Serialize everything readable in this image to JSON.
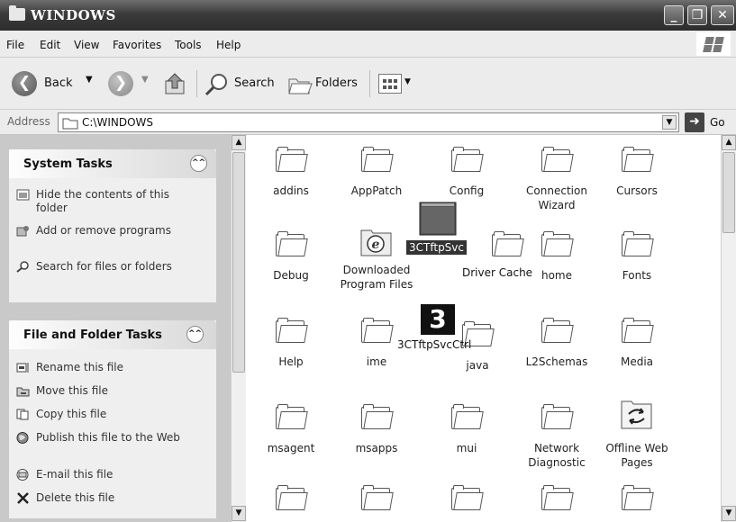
{
  "window": {
    "title": "WINDOWS"
  },
  "menu": [
    "File",
    "Edit",
    "View",
    "Favorites",
    "Tools",
    "Help"
  ],
  "toolbar": {
    "back": "Back",
    "search": "Search",
    "folders": "Folders"
  },
  "address": {
    "label": "Address",
    "value": "C:\\WINDOWS",
    "go": "Go"
  },
  "system_tasks": {
    "title": "System Tasks",
    "items": [
      {
        "icon": "hide-contents-icon",
        "label": "Hide the contents of this folder"
      },
      {
        "icon": "add-remove-programs-icon",
        "label": "Add or remove programs"
      },
      {
        "icon": "search-icon",
        "label": "Search for files or folders"
      }
    ]
  },
  "file_tasks": {
    "title": "File and Folder Tasks",
    "items": [
      {
        "icon": "rename-icon",
        "label": "Rename this file"
      },
      {
        "icon": "move-icon",
        "label": "Move this file"
      },
      {
        "icon": "copy-icon",
        "label": "Copy this file"
      },
      {
        "icon": "publish-web-icon",
        "label": "Publish this file to the Web"
      },
      {
        "icon": "email-icon",
        "label": "E-mail this file"
      },
      {
        "icon": "delete-icon",
        "label": "Delete this file"
      }
    ]
  },
  "items": [
    "addins",
    "AppPatch",
    "Config",
    "Connection Wizard",
    "Cursors",
    "Debug",
    "Downloaded Program Files",
    "Driver Cache",
    "home",
    "Fonts",
    "Help",
    "ime",
    "java",
    "L2Schemas",
    "Media",
    "msagent",
    "msapps",
    "mui",
    "Network Diagnostic",
    "Offline Web Pages"
  ],
  "overlays": {
    "svc": "3CTftpSvc",
    "svcctrl": "3CTftpSvcCtrl",
    "svcctrl_glyph": "3"
  }
}
